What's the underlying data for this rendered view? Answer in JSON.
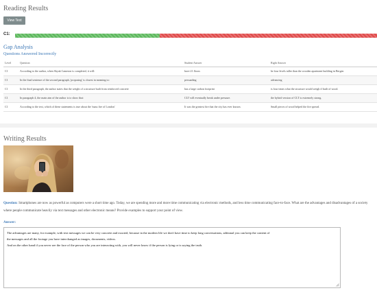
{
  "reading": {
    "title": "Reading Results",
    "view_text_label": "View Text",
    "level_label": "C1:",
    "progress_correct_fraction": 0.4,
    "colors": {
      "correct": "#5cb85c",
      "incorrect": "#e04b4b",
      "accent": "#3a76b5"
    },
    "gap_title": "Gap Analysis",
    "gap_subtitle": "Questions Answered Incorrectly",
    "table": {
      "headers": [
        "Level",
        "Question",
        "Student Answer",
        "Right Answer"
      ],
      "rows": [
        [
          "C1",
          "According to the author, when Skyak Cameron is completed, it will:",
          "have 21 floors",
          "be four levels taller than the wooden apartment building in Bergen"
        ],
        [
          "C1",
          "In the final sentence of the second paragraph, 'proposing' is closest in meaning to:",
          "persuading",
          "advancing"
        ],
        [
          "C1",
          "In the third paragraph, the author states that the weight of a structure built from reinforced concrete",
          "has a large carbon footprint",
          "is four times what the structure would weigh if built of wood."
        ],
        [
          "C1",
          "In paragraph 4, the main aim of the author is to show that:",
          "CLT will eventually break under pressure.",
          "the hybrid version of CLT is extremely strong."
        ],
        [
          "C1",
          "According to the text, which of these statements is true about the 'mass fire of London'",
          "It was the greatest fire that the city has ever known.",
          "Small pieces of wood helped the fire spread."
        ]
      ]
    }
  },
  "writing": {
    "title": "Writing Results",
    "question_label": "Question:",
    "question_text": "Smartphones are now as powerful as computers were a short time ago. Today, we are spending more and more time communicating via electronic methods, and less time communicating face-to-face. What are the advantages and disadvantages of a society where people communicate heavily via text messages and other electronic means? Provide examples to support your point of view.",
    "answer_label": "Answer:",
    "answer": {
      "line1": "The advantages are many,  for example,  with text messages we can be very concrete and exacted,  because  in the modern life we don't have time to  keep long conversations,  aditional you can keep the  content of",
      "line2": "the messages and all the footage you have interchanged as  images, documents, videos.",
      "line3": "And on the other hand  if you never see the face of the person who you are interacting with,  you will  never know if the person is lying or is saying the truth."
    }
  }
}
